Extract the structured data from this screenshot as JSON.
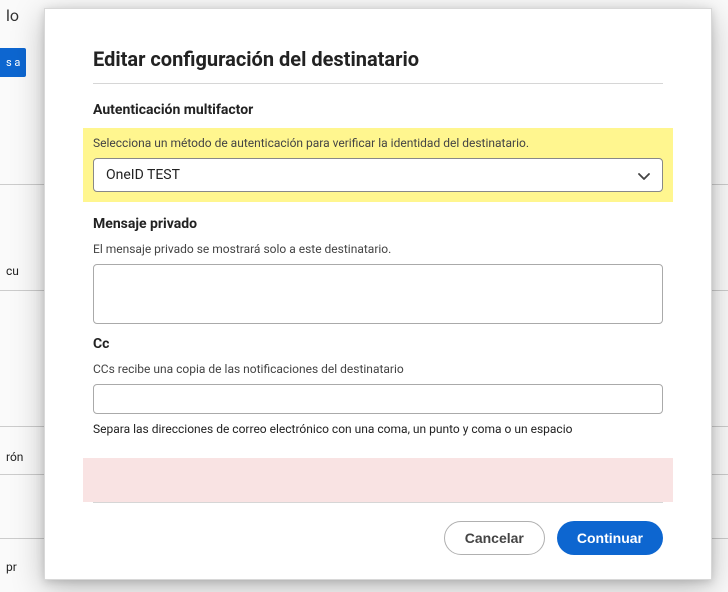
{
  "background": {
    "partial_text_top": "lo",
    "blue_button_text": "s a",
    "label_cu": "cu",
    "label_ron": "rón",
    "label_pr": "pr"
  },
  "modal": {
    "title": "Editar configuración del destinatario",
    "mfa": {
      "heading": "Autenticación multifactor",
      "helper": "Selecciona un método de autenticación para verificar la identidad del destinatario.",
      "selected_value": "OneID TEST"
    },
    "private_message": {
      "heading": "Mensaje privado",
      "helper": "El mensaje privado se mostrará solo a este destinatario.",
      "value": ""
    },
    "cc": {
      "heading": "Cc",
      "helper": "CCs recibe una copia de las notificaciones del destinatario",
      "value": "",
      "hint": "Separa las direcciones de correo electrónico con una coma, un punto y coma o un espacio"
    },
    "buttons": {
      "cancel": "Cancelar",
      "continue": "Continuar"
    }
  }
}
